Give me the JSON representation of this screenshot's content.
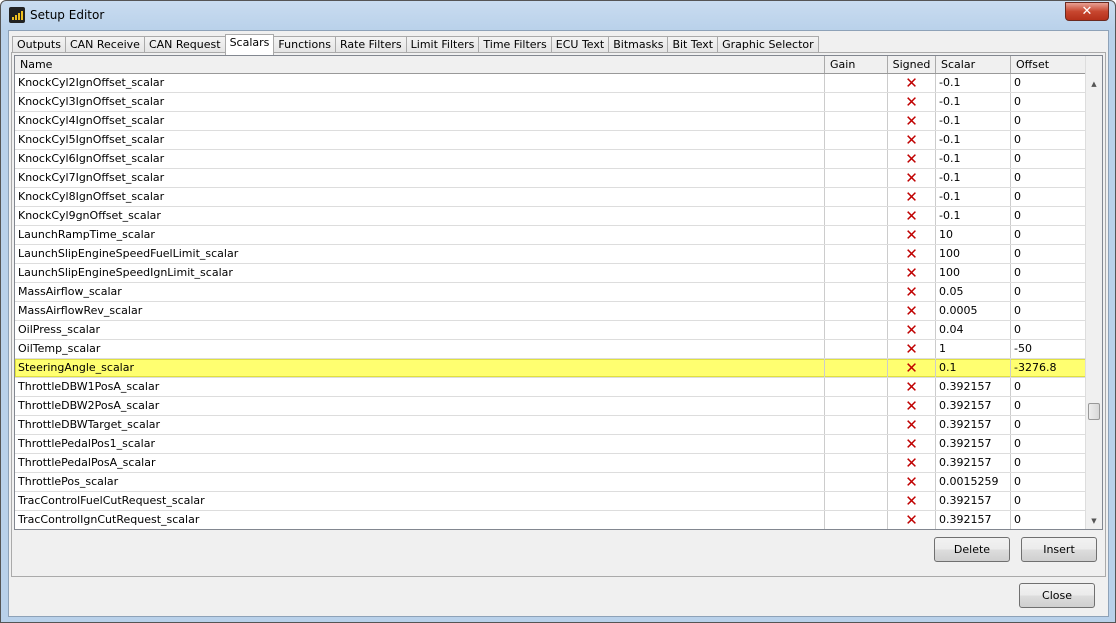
{
  "window": {
    "title": "Setup Editor",
    "close_label": "✕"
  },
  "tabs": [
    "Outputs",
    "CAN Receive",
    "CAN Request",
    "Scalars",
    "Functions",
    "Rate Filters",
    "Limit Filters",
    "Time Filters",
    "ECU Text",
    "Bitmasks",
    "Bit Text",
    "Graphic Selector"
  ],
  "active_tab": "Scalars",
  "table": {
    "columns": [
      "Name",
      "Gain",
      "Signed",
      "Scalar",
      "Offset"
    ],
    "signed_icon": "red-x-icon",
    "signed_glyph": "✕",
    "selected_row": "SteeringAngle_scalar",
    "rows": [
      {
        "name": "KnockCyl2IgnOffset_scalar",
        "gain": "",
        "scalar": "-0.1",
        "offset": "0"
      },
      {
        "name": "KnockCyl3IgnOffset_scalar",
        "gain": "",
        "scalar": "-0.1",
        "offset": "0"
      },
      {
        "name": "KnockCyl4IgnOffset_scalar",
        "gain": "",
        "scalar": "-0.1",
        "offset": "0"
      },
      {
        "name": "KnockCyl5IgnOffset_scalar",
        "gain": "",
        "scalar": "-0.1",
        "offset": "0"
      },
      {
        "name": "KnockCyl6IgnOffset_scalar",
        "gain": "",
        "scalar": "-0.1",
        "offset": "0"
      },
      {
        "name": "KnockCyl7IgnOffset_scalar",
        "gain": "",
        "scalar": "-0.1",
        "offset": "0"
      },
      {
        "name": "KnockCyl8IgnOffset_scalar",
        "gain": "",
        "scalar": "-0.1",
        "offset": "0"
      },
      {
        "name": "KnockCyl9gnOffset_scalar",
        "gain": "",
        "scalar": "-0.1",
        "offset": "0"
      },
      {
        "name": "LaunchRampTime_scalar",
        "gain": "",
        "scalar": "10",
        "offset": "0"
      },
      {
        "name": "LaunchSlipEngineSpeedFuelLimit_scalar",
        "gain": "",
        "scalar": "100",
        "offset": "0"
      },
      {
        "name": "LaunchSlipEngineSpeedIgnLimit_scalar",
        "gain": "",
        "scalar": "100",
        "offset": "0"
      },
      {
        "name": "MassAirflow_scalar",
        "gain": "",
        "scalar": "0.05",
        "offset": "0"
      },
      {
        "name": "MassAirflowRev_scalar",
        "gain": "",
        "scalar": "0.0005",
        "offset": "0"
      },
      {
        "name": "OilPress_scalar",
        "gain": "",
        "scalar": "0.04",
        "offset": "0"
      },
      {
        "name": "OilTemp_scalar",
        "gain": "",
        "scalar": "1",
        "offset": "-50"
      },
      {
        "name": "SteeringAngle_scalar",
        "gain": "",
        "scalar": "0.1",
        "offset": "-3276.8"
      },
      {
        "name": "ThrottleDBW1PosA_scalar",
        "gain": "",
        "scalar": "0.392157",
        "offset": "0"
      },
      {
        "name": "ThrottleDBW2PosA_scalar",
        "gain": "",
        "scalar": "0.392157",
        "offset": "0"
      },
      {
        "name": "ThrottleDBWTarget_scalar",
        "gain": "",
        "scalar": "0.392157",
        "offset": "0"
      },
      {
        "name": "ThrottlePedalPos1_scalar",
        "gain": "",
        "scalar": "0.392157",
        "offset": "0"
      },
      {
        "name": "ThrottlePedalPosA_scalar",
        "gain": "",
        "scalar": "0.392157",
        "offset": "0"
      },
      {
        "name": "ThrottlePos_scalar",
        "gain": "",
        "scalar": "0.0015259",
        "offset": "0"
      },
      {
        "name": "TracControlFuelCutRequest_scalar",
        "gain": "",
        "scalar": "0.392157",
        "offset": "0"
      },
      {
        "name": "TracControlIgnCutRequest_scalar",
        "gain": "",
        "scalar": "0.392157",
        "offset": "0"
      }
    ]
  },
  "buttons": {
    "delete": "Delete",
    "insert": "Insert",
    "close": "Close"
  },
  "colors": {
    "selected_row": "#ffff70",
    "signed_x": "#c00000"
  }
}
